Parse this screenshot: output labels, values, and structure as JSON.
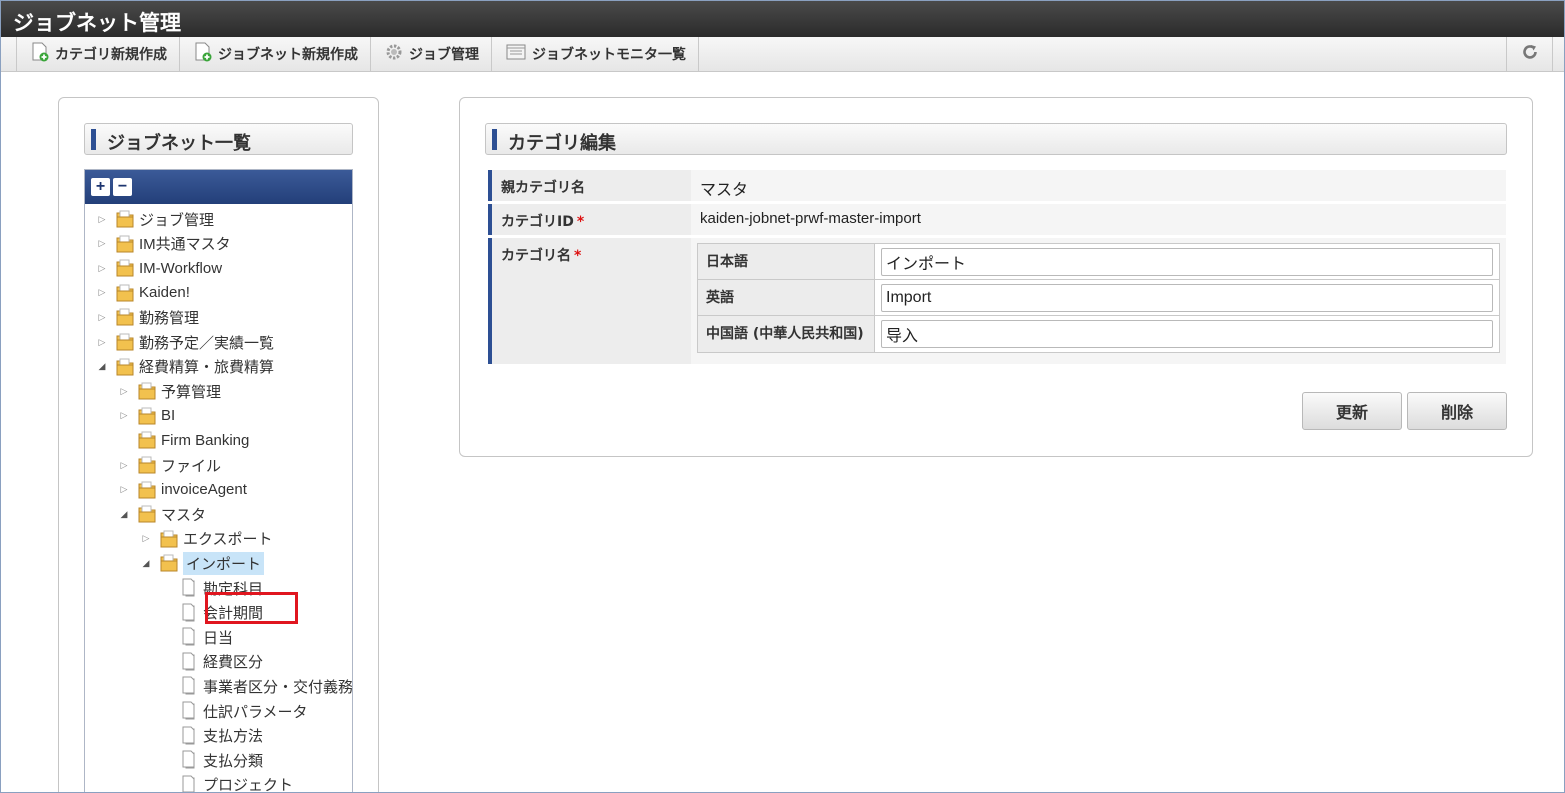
{
  "app": {
    "title": "ジョブネット管理"
  },
  "toolbar": {
    "items": [
      {
        "label": "カテゴリ新規作成",
        "icon": "new-document-icon"
      },
      {
        "label": "ジョブネット新規作成",
        "icon": "new-document-icon"
      },
      {
        "label": "ジョブ管理",
        "icon": "gear-icon"
      },
      {
        "label": "ジョブネットモニタ一覧",
        "icon": "monitor-list-icon"
      }
    ],
    "refresh_icon": "refresh-icon"
  },
  "left": {
    "title": "ジョブネット一覧",
    "expand_all_label": "+",
    "collapse_all_label": "−",
    "tree": [
      {
        "label": "ジョブ管理",
        "depth": 0,
        "state": "collapsed",
        "type": "folder"
      },
      {
        "label": "IM共通マスタ",
        "depth": 0,
        "state": "collapsed",
        "type": "folder"
      },
      {
        "label": "IM-Workflow",
        "depth": 0,
        "state": "collapsed",
        "type": "folder"
      },
      {
        "label": "Kaiden!",
        "depth": 0,
        "state": "collapsed",
        "type": "folder"
      },
      {
        "label": "勤務管理",
        "depth": 0,
        "state": "collapsed",
        "type": "folder"
      },
      {
        "label": "勤務予定／実績一覧",
        "depth": 0,
        "state": "collapsed",
        "type": "folder"
      },
      {
        "label": "経費精算・旅費精算",
        "depth": 0,
        "state": "expanded",
        "type": "folder"
      },
      {
        "label": "予算管理",
        "depth": 1,
        "state": "collapsed",
        "type": "folder"
      },
      {
        "label": "BI",
        "depth": 1,
        "state": "collapsed",
        "type": "folder"
      },
      {
        "label": "Firm Banking",
        "depth": 1,
        "state": "leaf",
        "type": "folder"
      },
      {
        "label": "ファイル",
        "depth": 1,
        "state": "collapsed",
        "type": "folder"
      },
      {
        "label": "invoiceAgent",
        "depth": 1,
        "state": "collapsed",
        "type": "folder"
      },
      {
        "label": "マスタ",
        "depth": 1,
        "state": "expanded",
        "type": "folder"
      },
      {
        "label": "エクスポート",
        "depth": 2,
        "state": "collapsed",
        "type": "folder"
      },
      {
        "label": "インポート",
        "depth": 2,
        "state": "expanded",
        "type": "folder",
        "selected": true
      },
      {
        "label": "勘定科目",
        "depth": 3,
        "state": "leaf",
        "type": "doc"
      },
      {
        "label": "会計期間",
        "depth": 3,
        "state": "leaf",
        "type": "doc",
        "highlighted": true
      },
      {
        "label": "日当",
        "depth": 3,
        "state": "leaf",
        "type": "doc"
      },
      {
        "label": "経費区分",
        "depth": 3,
        "state": "leaf",
        "type": "doc"
      },
      {
        "label": "事業者区分・交付義務",
        "depth": 3,
        "state": "leaf",
        "type": "doc"
      },
      {
        "label": "仕訳パラメータ",
        "depth": 3,
        "state": "leaf",
        "type": "doc"
      },
      {
        "label": "支払方法",
        "depth": 3,
        "state": "leaf",
        "type": "doc"
      },
      {
        "label": "支払分類",
        "depth": 3,
        "state": "leaf",
        "type": "doc"
      },
      {
        "label": "プロジェクト",
        "depth": 3,
        "state": "leaf",
        "type": "doc"
      }
    ]
  },
  "form": {
    "title": "カテゴリ編集",
    "parent_label": "親カテゴリ名",
    "parent_value": "マスタ",
    "id_label": "カテゴリID",
    "id_value": "kaiden-jobnet-prwf-master-import",
    "name_label": "カテゴリ名",
    "required_mark": "*",
    "names": [
      {
        "lang": "日本語",
        "value": "インポート"
      },
      {
        "lang": "英語",
        "value": "Import"
      },
      {
        "lang": "中国語 (中華人民共和国)",
        "value": "导入"
      }
    ],
    "update_label": "更新",
    "delete_label": "削除"
  },
  "colors": {
    "accent": "#2d4f93",
    "titlebar": "#2b2b2b",
    "selection": "#c8e4f8",
    "highlight": "#e0161f",
    "folder": "#f2c14e"
  }
}
